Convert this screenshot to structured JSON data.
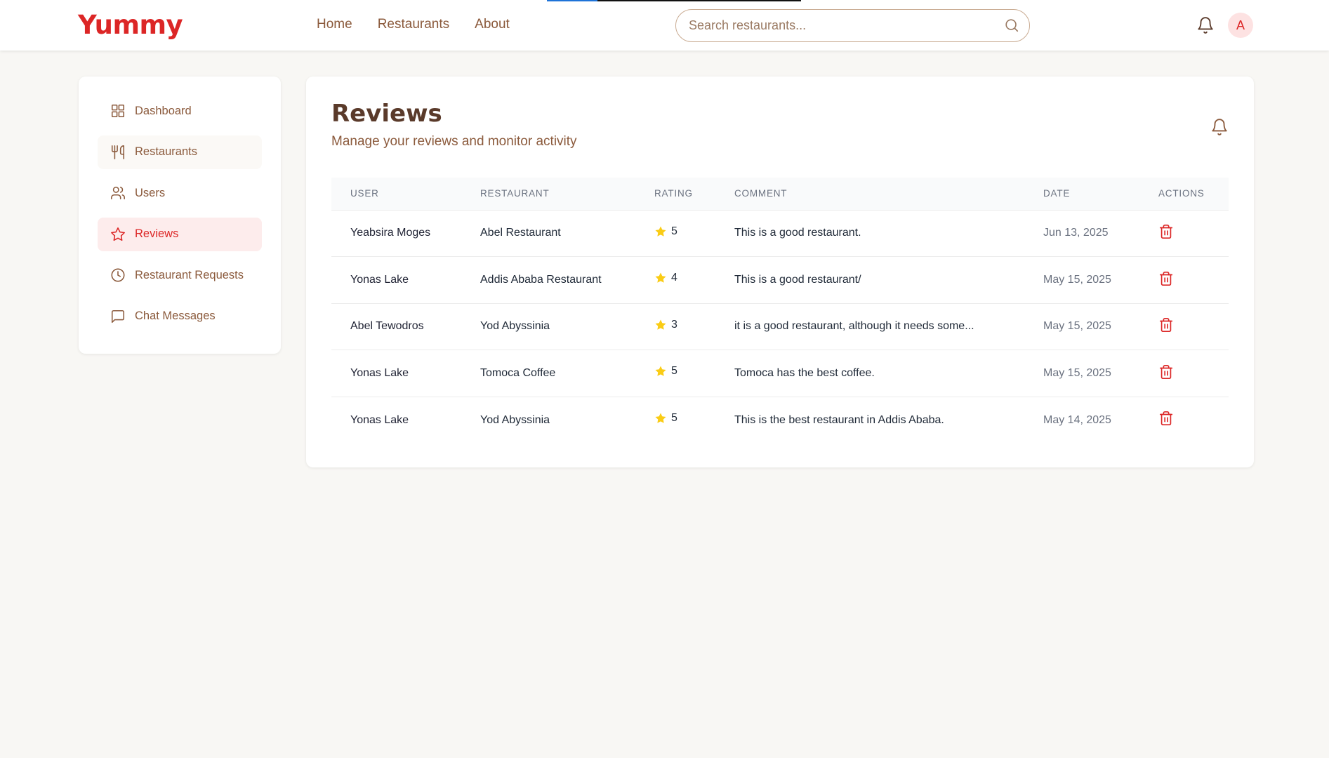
{
  "header": {
    "logo": "Yummy",
    "nav": [
      {
        "label": "Home"
      },
      {
        "label": "Restaurants"
      },
      {
        "label": "About"
      }
    ],
    "search": {
      "placeholder": "Search restaurants...",
      "value": ""
    },
    "avatar_initial": "A",
    "page_load_progress": 0.2
  },
  "sidebar": {
    "items": [
      {
        "label": "Dashboard",
        "icon": "grid-icon"
      },
      {
        "label": "Restaurants",
        "icon": "utensils-icon"
      },
      {
        "label": "Users",
        "icon": "users-icon"
      },
      {
        "label": "Reviews",
        "icon": "star-icon",
        "active": true
      },
      {
        "label": "Restaurant Requests",
        "icon": "clock-icon"
      },
      {
        "label": "Chat Messages",
        "icon": "message-icon"
      }
    ]
  },
  "main": {
    "title": "Reviews",
    "subtitle": "Manage your reviews and monitor activity",
    "table": {
      "columns": [
        "USER",
        "RESTAURANT",
        "RATING",
        "COMMENT",
        "DATE",
        "ACTIONS"
      ],
      "rows": [
        {
          "user": "Yeabsira Moges",
          "restaurant": "Abel Restaurant",
          "rating": "5",
          "comment": "This is a good restaurant.",
          "date": "Jun 13, 2025"
        },
        {
          "user": "Yonas Lake",
          "restaurant": "Addis Ababa Restaurant",
          "rating": "4",
          "comment": "This is a good restaurant/",
          "date": "May 15, 2025"
        },
        {
          "user": "Abel Tewodros",
          "restaurant": "Yod Abyssinia",
          "rating": "3",
          "comment": "it is a good restaurant, although it needs some...",
          "date": "May 15, 2025"
        },
        {
          "user": "Yonas Lake",
          "restaurant": "Tomoca Coffee",
          "rating": "5",
          "comment": "Tomoca has the best coffee.",
          "date": "May 15, 2025"
        },
        {
          "user": "Yonas Lake",
          "restaurant": "Yod Abyssinia",
          "rating": "5",
          "comment": "This is the best restaurant in Addis Ababa.",
          "date": "May 14, 2025"
        }
      ]
    }
  },
  "colors": {
    "brand": "#dc2626",
    "accent_brown": "#8b5a3c",
    "star": "#facc15",
    "progress": "#1e73d8"
  }
}
